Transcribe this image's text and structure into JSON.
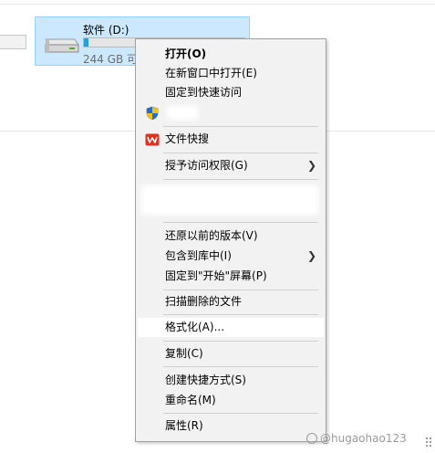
{
  "drive": {
    "name": "软件 (D:)",
    "free_text": "244 GB 可",
    "usage_fraction": 0.03
  },
  "menu": {
    "items": [
      {
        "label": "打开(O)",
        "bold": true
      },
      {
        "label": "在新窗口中打开(E)"
      },
      {
        "label": "固定到快速访问"
      },
      {
        "label": ""
      },
      {
        "label": "文件快搜"
      },
      {
        "label": "授予访问权限(G)"
      },
      {
        "label": "还原以前的版本(V)"
      },
      {
        "label": "包含到库中(I)"
      },
      {
        "label": "固定到\"开始\"屏幕(P)"
      },
      {
        "label": "扫描删除的文件"
      },
      {
        "label": "格式化(A)..."
      },
      {
        "label": "复制(C)"
      },
      {
        "label": "创建快捷方式(S)"
      },
      {
        "label": "重命名(M)"
      },
      {
        "label": "属性(R)"
      }
    ]
  },
  "watermark": {
    "text": "@hugaohao123"
  },
  "colors": {
    "selection_bg": "#cce8ff",
    "selection_border": "#99d1ff",
    "usage_bar": "#26a0da",
    "menu_bg": "#f2f2f2",
    "wps_red": "#e0301e"
  },
  "icons": {
    "drive": "hard-drive-icon",
    "shield": "uac-shield-icon",
    "wps": "wps-logo-icon",
    "submenu": "chevron-right-icon"
  }
}
